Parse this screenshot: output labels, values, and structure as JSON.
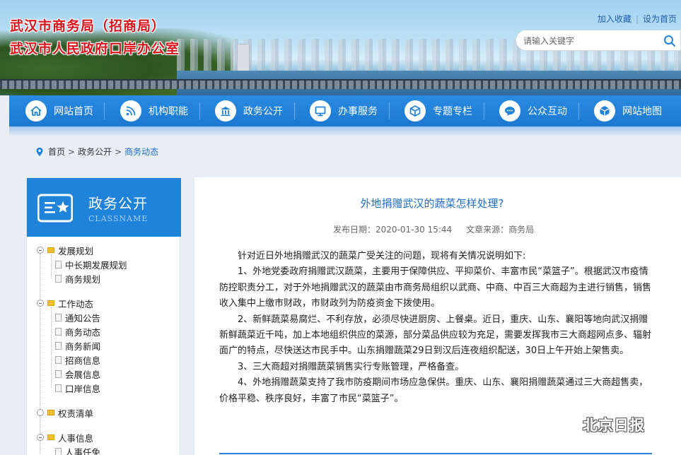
{
  "header": {
    "title_line1": "武汉市商务局（招商局）",
    "title_line2": "武汉市人民政府口岸办公室",
    "links": [
      "加入收藏",
      "设为首页"
    ],
    "search_placeholder": "请输入关键字"
  },
  "nav": [
    {
      "label": "网站首页",
      "icon": "home-icon"
    },
    {
      "label": "机构职能",
      "icon": "rss-icon"
    },
    {
      "label": "政务公开",
      "icon": "government-building-icon"
    },
    {
      "label": "办事服务",
      "icon": "monitor-icon"
    },
    {
      "label": "专题专栏",
      "icon": "cube-icon"
    },
    {
      "label": "公众互动",
      "icon": "chat-bubble-icon"
    },
    {
      "label": "网站地图",
      "icon": "box-icon"
    }
  ],
  "breadcrumb": {
    "sep": ">",
    "items": [
      "首页",
      "政务公开",
      "商务动态"
    ]
  },
  "sidebar": {
    "title": "政务公开",
    "subtitle": "CLASSNAME",
    "tree": [
      {
        "label": "发展规划",
        "level": 0
      },
      {
        "label": "中长期发展规划",
        "level": 1
      },
      {
        "label": "商务规划",
        "level": 1
      },
      {
        "label": "工作动态",
        "level": 0
      },
      {
        "label": "通知公告",
        "level": 1
      },
      {
        "label": "商务动态",
        "level": 1
      },
      {
        "label": "商务新闻",
        "level": 1
      },
      {
        "label": "招商信息",
        "level": 1
      },
      {
        "label": "会展信息",
        "level": 1
      },
      {
        "label": "口岸信息",
        "level": 1
      },
      {
        "label": "权责清单",
        "level": 0
      },
      {
        "label": "人事信息",
        "level": 0
      },
      {
        "label": "人事任免",
        "level": 1
      }
    ]
  },
  "article": {
    "title": "外地捐赠武汉的蔬菜怎样处理?",
    "date_label": "发布日期：2020-01-30 15:44",
    "source_label": "文章来源：商务局",
    "paragraphs": [
      "针对近日外地捐赠武汉的蔬菜广受关注的问题，现将有关情况说明如下:",
      "1、外地党委政府捐赠武汉蔬菜，主要用于保障供应、平抑菜价、丰富市民“菜篮子”。根据武汉市疫情防控职责分工，对于外地捐赠武汉的蔬菜由市商务局组织以武商、中商、中百三大商超为主进行销售，销售收入集中上缴市财政，市财政列为防疫资金下拨使用。",
      "2、新鲜蔬菜易腐烂、不利存放，必须尽快进厨房、上餐桌。近日，重庆、山东、襄阳等地向武汉捐赠新鲜蔬菜近千吨，加上本地组织供应的菜源，部分菜品供应较为充足，需要发挥我市三大商超网点多、辐射面广的特点，尽快送达市民手中。山东捐赠蔬菜29日到汉后连夜组织配送，30日上午开始上架售卖。",
      "3、三大商超对捐赠蔬菜销售实行专账管理，严格备查。",
      "4、外地捐赠蔬菜支持了我市防疫期间市场应急保供。重庆、山东、襄阳捐赠蔬菜通过三大商超售卖，价格平稳、秩序良好，丰富了市民“菜篮子”。"
    ]
  },
  "watermark": {
    "text": "北京日报"
  },
  "colors": {
    "nav_blue": "#1f83da",
    "title_red": "#d8141c",
    "link_blue": "#1c6fc6"
  }
}
